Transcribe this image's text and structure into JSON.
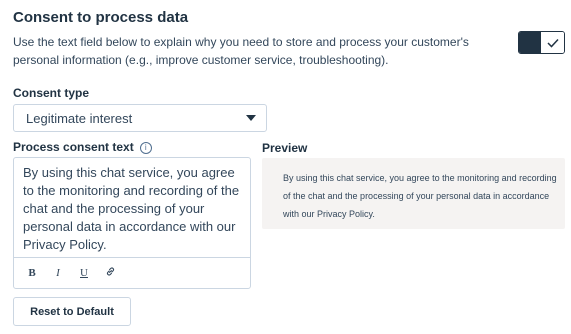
{
  "section": {
    "title": "Consent to process data",
    "description": "Use the text field below to explain why you need to store and process your customer's personal information (e.g., improve customer service, troubleshooting)."
  },
  "toggle": {
    "state": "on",
    "icon": "check-icon"
  },
  "consent_type": {
    "label": "Consent type",
    "selected": "Legitimate interest"
  },
  "process_text": {
    "label": "Process consent text",
    "info_glyph": "i",
    "value": "By using this chat service, you agree to the monitoring and recording of the chat and the processing of your personal data in accordance with our Privacy Policy."
  },
  "toolbar": {
    "bold": "B",
    "italic": "I",
    "underline": "U",
    "link_icon": "link-icon"
  },
  "preview": {
    "label": "Preview",
    "text": "By using this chat service, you agree to the monitoring and recording of the chat and the processing of your personal data in accordance with our Privacy Policy."
  },
  "reset_button": {
    "label": "Reset to Default"
  }
}
